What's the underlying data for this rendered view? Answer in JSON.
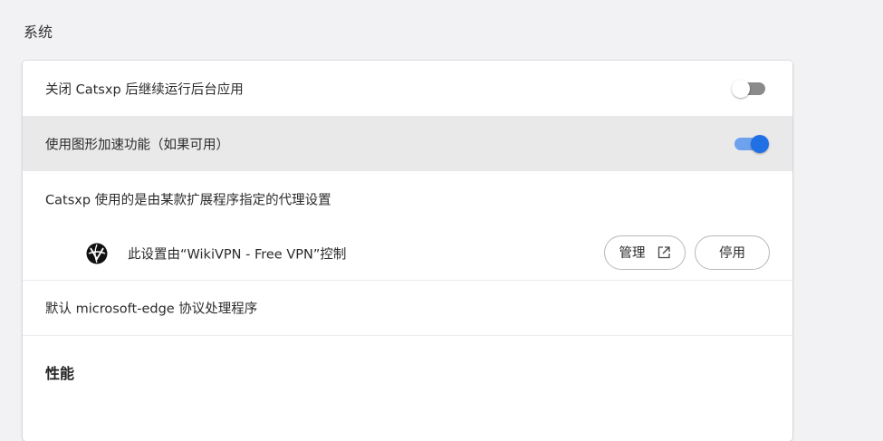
{
  "section": {
    "title": "系统"
  },
  "settings": {
    "background_apps": {
      "label": "关闭 Catsxp 后继续运行后台应用",
      "enabled": false
    },
    "hardware_accel": {
      "label": "使用图形加速功能（如果可用）",
      "enabled": true
    },
    "proxy": {
      "label": "Catsxp 使用的是由某款扩展程序指定的代理设置"
    },
    "proxy_extension": {
      "label": "此设置由“WikiVPN - Free VPN”控制",
      "icon": "wikivpn-logo-icon",
      "manage_label": "管理",
      "disable_label": "停用"
    },
    "protocol_handler": {
      "label": "默认 microsoft-edge 协议处理程序"
    }
  },
  "performance": {
    "title": "性能"
  },
  "colors": {
    "accent": "#1f6fe5",
    "toggle_on_track": "#6fa2ee",
    "toggle_off_track": "#8a8a8a",
    "highlight_row": "#e9e9ea"
  }
}
